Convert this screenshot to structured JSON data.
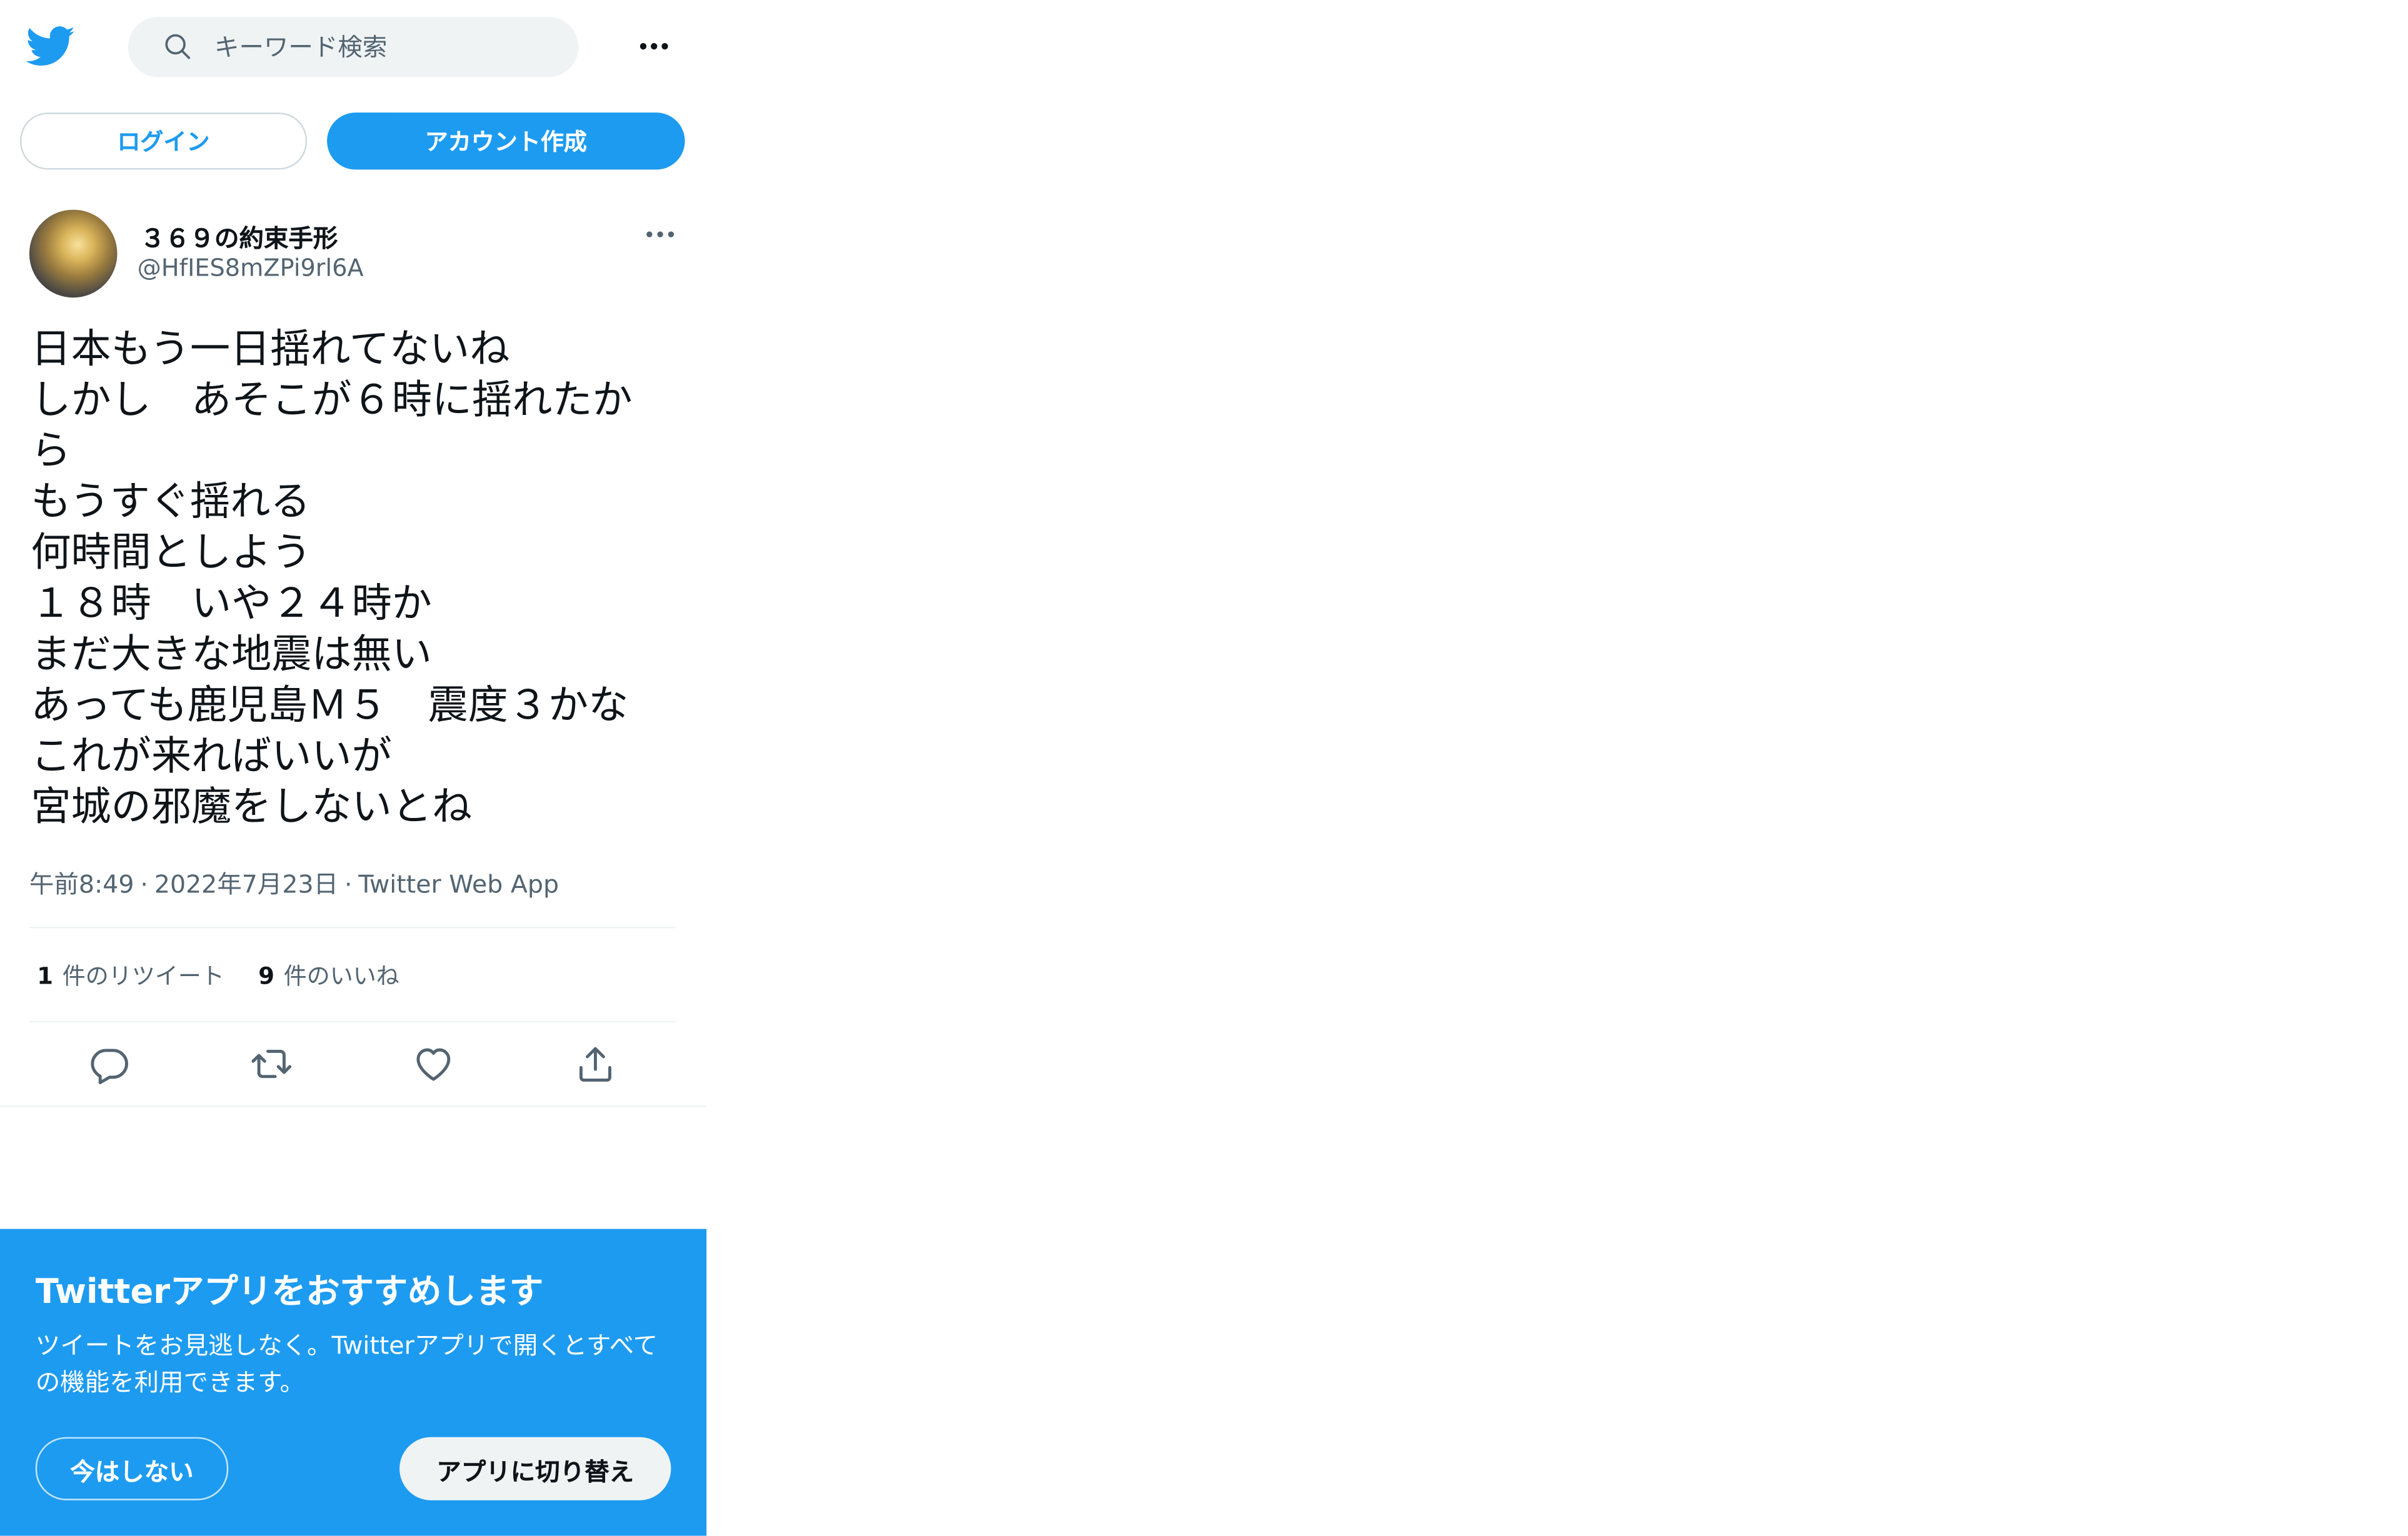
{
  "colors": {
    "accent": "#1d9bf0",
    "text": "#0f1419",
    "muted": "#536471",
    "divider": "#eff3f4"
  },
  "header": {
    "logo_icon": "twitter-bird-icon",
    "search_placeholder": "キーワード検索",
    "search_icon": "search-icon",
    "more_icon": "more-horizontal-icon"
  },
  "auth": {
    "login_label": "ログイン",
    "signup_label": "アカウント作成"
  },
  "tweet": {
    "display_name": "３６９の約束手形",
    "handle": "@HfIES8mZPi9rl6A",
    "text_lines": [
      "日本もう一日揺れてないね",
      "しかし　あそこが６時に揺れたか",
      "ら",
      "もうすぐ揺れる",
      "何時間としよう",
      "１８時　いや２４時か",
      "まだ大きな地震は無い",
      "あっても鹿児島Ｍ５　震度３かな",
      "これが来ればいいが",
      "宮城の邪魔をしないとね"
    ],
    "time": "午前8:49",
    "date": "2022年7月23日",
    "separator": "·",
    "source": "Twitter Web App",
    "retweets_count": "1",
    "retweets_label": "件のリツイート",
    "likes_count": "9",
    "likes_label": "件のいいね"
  },
  "banner": {
    "title": "Twitterアプリをおすすめします",
    "description": "ツイートをお見逃しなく。Twitterアプリで開くとすべての機能を利用できます。",
    "not_now_label": "今はしない",
    "switch_label": "アプリに切り替え"
  }
}
